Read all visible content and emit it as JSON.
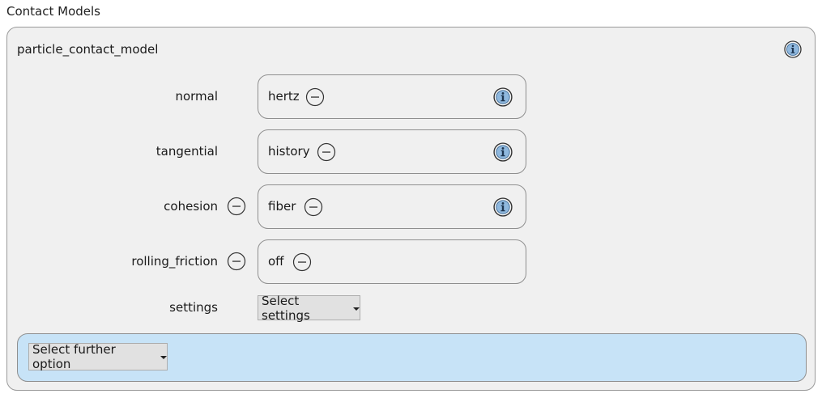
{
  "section": {
    "title": "Contact Models"
  },
  "model": {
    "name": "particle_contact_model",
    "rows": [
      {
        "label": "normal",
        "value": "hertz",
        "removable": false,
        "has_info": true
      },
      {
        "label": "tangential",
        "value": "history",
        "removable": false,
        "has_info": true
      },
      {
        "label": "cohesion",
        "value": "fiber",
        "removable": true,
        "has_info": true
      },
      {
        "label": "rolling_friction",
        "value": "off",
        "removable": true,
        "has_info": false
      }
    ],
    "settings": {
      "label": "settings",
      "select_label": "Select settings"
    },
    "further": {
      "select_label": "Select further option"
    }
  },
  "icons": {
    "info": "info-icon",
    "remove": "minus-circle-icon",
    "dropdown": "caret-down-icon"
  },
  "colors": {
    "panel_bg": "#f0f0f0",
    "further_bg": "#c7e3f7",
    "info_fill": "#8fb8de",
    "border": "#8f8f8f"
  }
}
